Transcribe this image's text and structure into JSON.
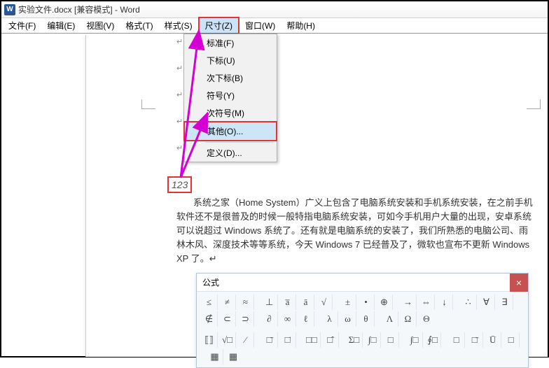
{
  "titlebar": {
    "app_letter": "W",
    "title": "实验文件.docx [兼容模式] - Word"
  },
  "menubar": {
    "items": [
      {
        "label": "文件(F)"
      },
      {
        "label": "编辑(E)"
      },
      {
        "label": "视图(V)"
      },
      {
        "label": "格式(T)"
      },
      {
        "label": "样式(S)"
      },
      {
        "label": "尺寸(Z)",
        "highlighted": true
      },
      {
        "label": "窗口(W)"
      },
      {
        "label": "帮助(H)"
      }
    ]
  },
  "dropdown": {
    "items": [
      {
        "label": "标准(F)",
        "checked": true
      },
      {
        "label": "下标(U)"
      },
      {
        "label": "次下标(B)"
      },
      {
        "label": "符号(Y)"
      },
      {
        "label": "次符号(M)"
      },
      {
        "label": "其他(O)...",
        "selected": true,
        "redbox": true
      },
      {
        "sep": true
      },
      {
        "label": "定义(D)..."
      }
    ]
  },
  "document": {
    "field_value": "123",
    "paragraph": "系统之家（Home System）广义上包含了电脑系统安装和手机系统安装，在之前手机软件还不是很普及的时候一般特指电脑系统安装，可如今手机用户大量的出现，安卓系统可以说超过 Windows 系统了。还有就是电脑系统的安装了，我们所熟悉的电脑公司、雨林木风、深度技术等等系统，今天 Windows 7 已经普及了，微软也宣布不更新 Windows XP 了。↵"
  },
  "formula": {
    "title": "公式",
    "close": "×",
    "row1": [
      "≤",
      "≠",
      "≈",
      "",
      "⊥",
      "a̅",
      "ā",
      "√",
      "",
      "±",
      "•",
      "⊕",
      "",
      "→",
      "⇔",
      "↓",
      "",
      "∴",
      "∀",
      "∃",
      "",
      "∉",
      "⊂",
      "⊃",
      "",
      "∂",
      "∞",
      "ℓ",
      "",
      "λ",
      "ω",
      "θ",
      "",
      "Λ",
      "Ω",
      "Θ"
    ],
    "row2": [
      "⟦⟧",
      "√□",
      "⁄",
      "",
      "□̄",
      "□̇",
      "",
      "□□",
      "□̂",
      "",
      "Σ□",
      "∫□",
      "□",
      "",
      "∫□",
      "∮□",
      "",
      "□",
      "□̄",
      "Ū",
      "□",
      "",
      "▦",
      "▦"
    ]
  }
}
